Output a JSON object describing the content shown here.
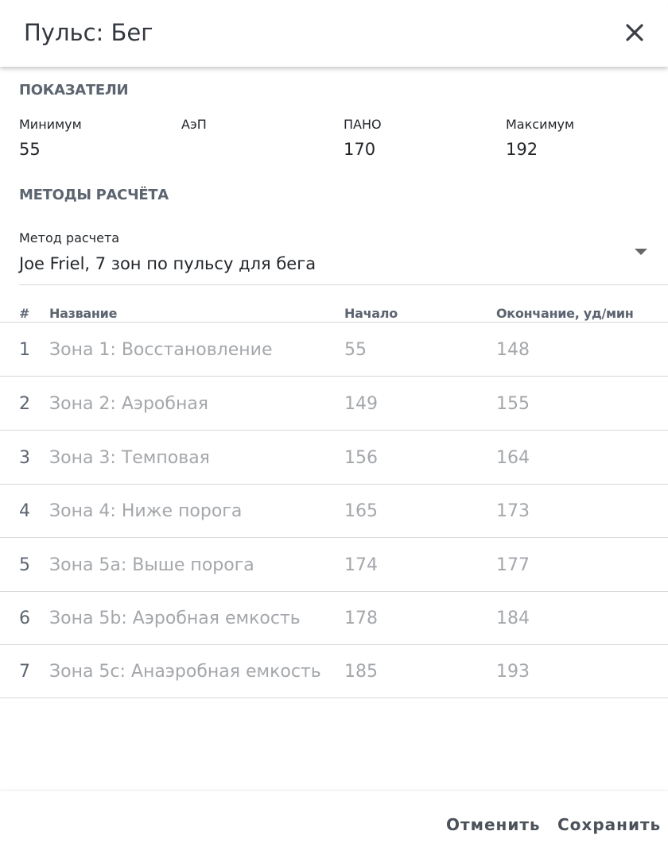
{
  "dialog": {
    "title": "Пульс: Бег"
  },
  "indicators": {
    "section_title": "ПОКАЗАТЕЛИ",
    "items": [
      {
        "label": "Минимум",
        "value": "55"
      },
      {
        "label": "АэП",
        "value": ""
      },
      {
        "label": "ПАНО",
        "value": "170"
      },
      {
        "label": "Максимум",
        "value": "192"
      }
    ]
  },
  "methods": {
    "section_title": "МЕТОДЫ РАСЧЁТА",
    "field_label": "Метод расчета",
    "selected": "Joe Friel, 7 зон по пульсу для бега"
  },
  "table": {
    "columns": [
      "#",
      "Название",
      "Начало",
      "Окончание, уд/мин"
    ],
    "rows": [
      {
        "num": "1",
        "name": "Зона 1: Восстановление",
        "start": "55",
        "end": "148"
      },
      {
        "num": "2",
        "name": "Зона 2: Аэробная",
        "start": "149",
        "end": "155"
      },
      {
        "num": "3",
        "name": "Зона 3: Темповая",
        "start": "156",
        "end": "164"
      },
      {
        "num": "4",
        "name": "Зона 4: Ниже порога",
        "start": "165",
        "end": "173"
      },
      {
        "num": "5",
        "name": "Зона 5а: Выше порога",
        "start": "174",
        "end": "177"
      },
      {
        "num": "6",
        "name": "Зона 5b: Аэробная емкость",
        "start": "178",
        "end": "184"
      },
      {
        "num": "7",
        "name": "Зона 5c: Анаэробная емкость",
        "start": "185",
        "end": "193"
      }
    ]
  },
  "footer": {
    "cancel_label": "Отменить",
    "save_label": "Сохранить"
  }
}
